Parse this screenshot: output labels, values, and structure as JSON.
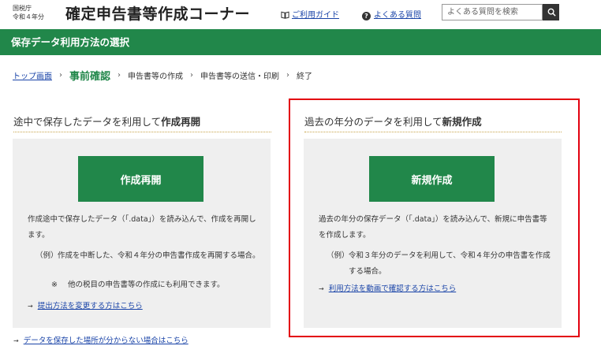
{
  "header": {
    "agency_line1": "国税庁",
    "agency_line2": "令和４年分",
    "app_title": "確定申告書等作成コーナー",
    "guide_link": "ご利用ガイド",
    "faq_link": "よくある質問",
    "search_placeholder": "よくある質問を検索",
    "icons": [
      "book-icon",
      "question-circle-icon",
      "search-icon"
    ]
  },
  "page_heading": "保存データ利用方法の選択",
  "breadcrumb": {
    "items": [
      "トップ画面",
      "事前確認",
      "申告書等の作成",
      "申告書等の送信・印刷",
      "終了"
    ],
    "separator": "›"
  },
  "left_panel": {
    "title_prefix": "途中で保存したデータを利用して",
    "title_bold": "作成再開",
    "button_label": "作成再開",
    "description": "作成途中で保存したデータ（「.data」）を読み込んで、作成を再開します。",
    "example_label": "（例）",
    "example_text": "作成を中断した、令和４年分の申告書作成を再開する場合。",
    "note_mark": "※",
    "note_text": "他の税目の申告書等の作成にも利用できます。",
    "link_text": "提出方法を変更する方はこちら"
  },
  "right_panel": {
    "title_prefix": "過去の年分のデータを利用して",
    "title_bold": "新規作成",
    "button_label": "新規作成",
    "description": "過去の年分の保存データ（「.data」）を読み込んで、新規に申告書等を作成します。",
    "example_label": "（例）",
    "example_text": "令和３年分のデータを利用して、令和４年分の申告書を作成する場合。",
    "link_text": "利用方法を動画で確認する方はこちら"
  },
  "bottom_link": "データを保存した場所が分からない場合はこちら",
  "colors": {
    "green": "#21874a",
    "link_blue": "#1a44a8",
    "highlight_red": "#e3000f",
    "panel_gray": "#efefef"
  }
}
